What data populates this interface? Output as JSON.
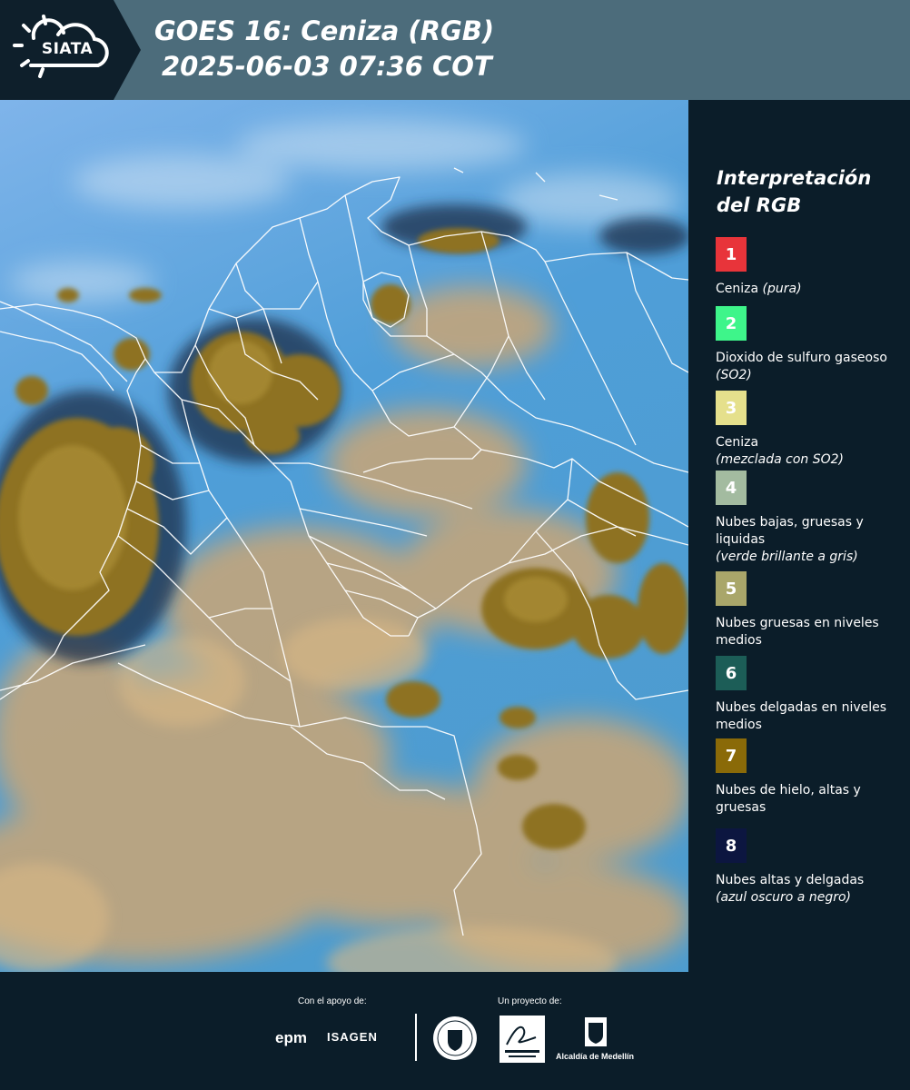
{
  "header": {
    "logo_text": "SIATA",
    "title_line1": "GOES 16: Ceniza (RGB)",
    "title_line2": "2025-06-03 07:36 COT"
  },
  "legend": {
    "title_line1": "Interpretación",
    "title_line2": "del RGB",
    "items": [
      {
        "number": "1",
        "color": "#e8343a",
        "text_color": "#ffffff",
        "label": "Ceniza",
        "note": "(pura)"
      },
      {
        "number": "2",
        "color": "#3ef58a",
        "text_color": "#ffffff",
        "label": "Dioxido de sulfuro gaseoso",
        "note": "(SO2)"
      },
      {
        "number": "3",
        "color": "#e5e08c",
        "text_color": "#ffffff",
        "label": "Ceniza",
        "note": "(mezclada con SO2)"
      },
      {
        "number": "4",
        "color": "#a3bba0",
        "text_color": "#ffffff",
        "label": "Nubes bajas, gruesas y liquidas",
        "note": "(verde brillante a gris)"
      },
      {
        "number": "5",
        "color": "#a9a66a",
        "text_color": "#ffffff",
        "label": "Nubes gruesas en niveles medios",
        "note": ""
      },
      {
        "number": "6",
        "color": "#1c5d57",
        "text_color": "#ffffff",
        "label": "Nubes delgadas en niveles medios",
        "note": ""
      },
      {
        "number": "7",
        "color": "#8a6a08",
        "text_color": "#ffffff",
        "label": "Nubes de hielo, altas y gruesas",
        "note": ""
      },
      {
        "number": "8",
        "color": "#0c1640",
        "text_color": "#ffffff",
        "label": "Nubes altas y delgadas",
        "note": "(azul oscuro a negro)"
      }
    ]
  },
  "footer": {
    "support_label": "Con el apoyo de:",
    "project_label": "Un proyecto de:",
    "epm": "epm",
    "isagen": "ISAGEN",
    "alcaldia": "Alcaldía de Medellín"
  }
}
